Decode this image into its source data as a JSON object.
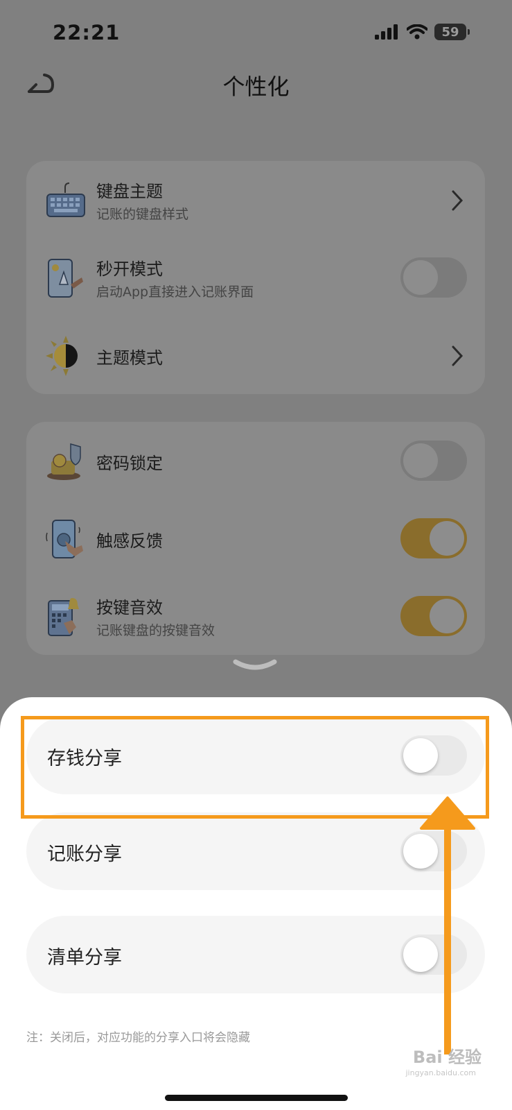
{
  "status_bar": {
    "time": "22:21",
    "battery": "59"
  },
  "header": {
    "title": "个性化"
  },
  "group1": [
    {
      "label": "键盘主题",
      "subtitle": "记账的键盘样式",
      "control": "chevron",
      "icon": "keyboard-icon"
    },
    {
      "label": "秒开模式",
      "subtitle": "启动App直接进入记账界面",
      "control": "toggle",
      "state": "off",
      "icon": "quick-launch-icon"
    },
    {
      "label": "主题模式",
      "control": "chevron",
      "icon": "sun-moon-icon"
    }
  ],
  "group2": [
    {
      "label": "密码锁定",
      "control": "toggle",
      "state": "off",
      "icon": "coin-lock-icon"
    },
    {
      "label": "触感反馈",
      "control": "toggle",
      "state": "on",
      "icon": "haptic-phone-icon"
    },
    {
      "label": "按键音效",
      "subtitle": "记账键盘的按键音效",
      "control": "toggle",
      "state": "on",
      "icon": "calculator-bell-icon"
    }
  ],
  "sheet": {
    "options": [
      {
        "label": "存钱分享",
        "state": "off"
      },
      {
        "label": "记账分享",
        "state": "off"
      },
      {
        "label": "清单分享",
        "state": "off"
      }
    ],
    "note": "注：关闭后，对应功能的分享入口将会隐藏"
  },
  "watermark": {
    "text": "Bai 经验",
    "sub": "jingyan.baidu.com"
  },
  "colors": {
    "accent": "#f59a1c",
    "toggle_on_dimmed": "#8a6d2c"
  }
}
